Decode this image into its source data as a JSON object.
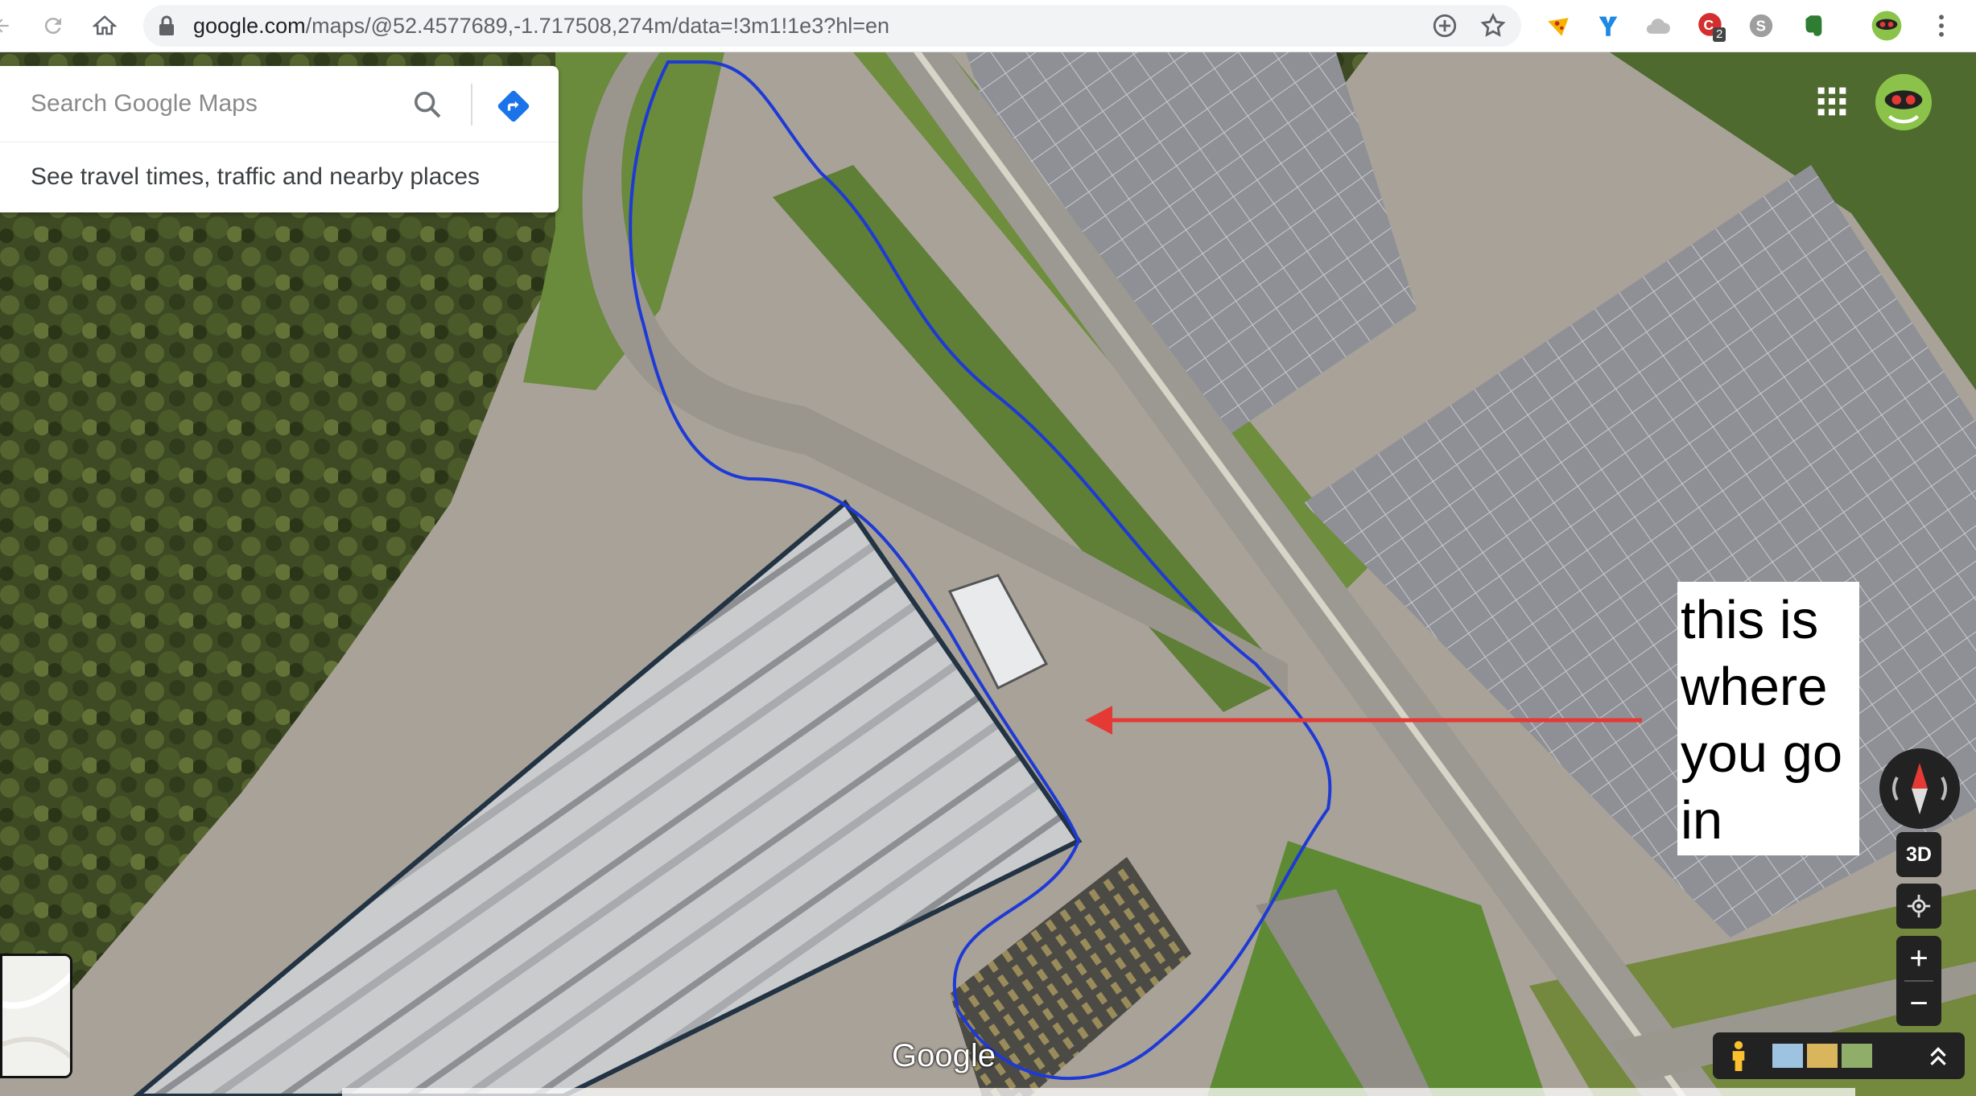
{
  "browser": {
    "url_host": "google.com",
    "url_path": "/maps/@52.4577689,-1.717508,274m/data=!3m1!1e3?hl=en",
    "extension_badge": "2",
    "icons": [
      "back-icon",
      "reload-icon",
      "home-icon",
      "lock-icon",
      "add-icon",
      "star-icon"
    ]
  },
  "search": {
    "placeholder": "Search Google Maps",
    "travel_text": "See travel times, traffic and nearby places"
  },
  "annotation": {
    "lines": [
      "this is",
      "where",
      "you go",
      "in"
    ],
    "arrow_color": "#e53935",
    "route_color": "#1e3ad6"
  },
  "map": {
    "view": "satellite",
    "latitude": 52.4577689,
    "longitude": -1.717508,
    "scale_m": 274,
    "logo": "Google",
    "control_3d": "3D",
    "zoom_in": "+",
    "zoom_out": "−"
  }
}
